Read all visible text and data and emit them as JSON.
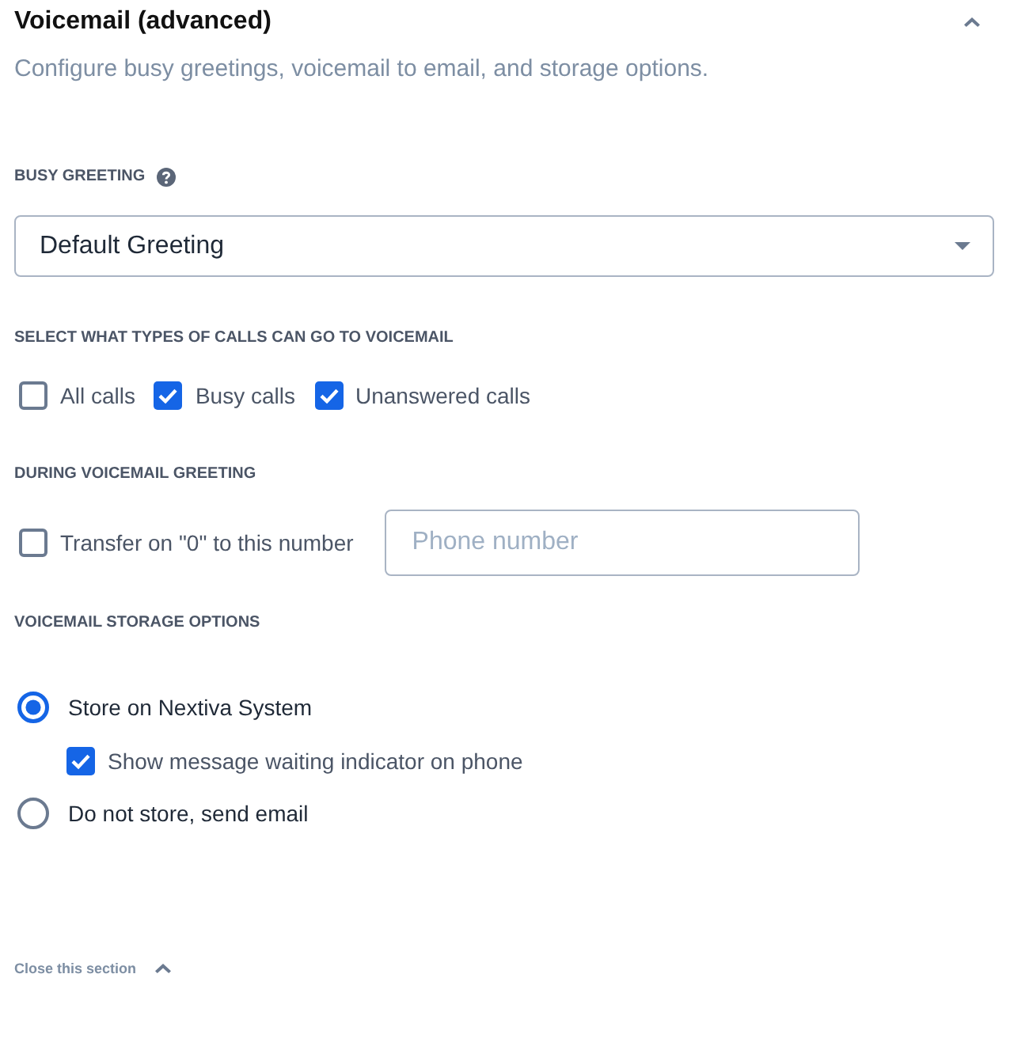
{
  "section": {
    "title": "Voicemail (advanced)",
    "expanded": true,
    "description": "Configure busy greetings, voicemail to email, and storage options."
  },
  "busy_greeting": {
    "label": "BUSY GREETING",
    "value": "Default Greeting"
  },
  "call_types": {
    "label": "SELECT WHAT TYPES OF CALLS CAN GO TO VOICEMAIL",
    "options": [
      {
        "label": "All calls",
        "checked": false
      },
      {
        "label": "Busy calls",
        "checked": true
      },
      {
        "label": "Unanswered calls",
        "checked": true
      }
    ]
  },
  "during_greeting": {
    "label": "DURING VOICEMAIL GREETING",
    "transfer": {
      "label": "Transfer on \"0\" to this number",
      "checked": false
    },
    "phone_field": {
      "placeholder": "Phone number"
    }
  },
  "storage": {
    "label": "VOICEMAIL STORAGE OPTIONS",
    "options": [
      {
        "label": "Store on Nextiva System",
        "selected": true,
        "suboptions": [
          {
            "label": "Show message waiting indicator on phone",
            "checked": true
          }
        ]
      },
      {
        "label": "Do not store, send email",
        "selected": false
      }
    ]
  },
  "close_link": {
    "label": "Close this section"
  }
}
